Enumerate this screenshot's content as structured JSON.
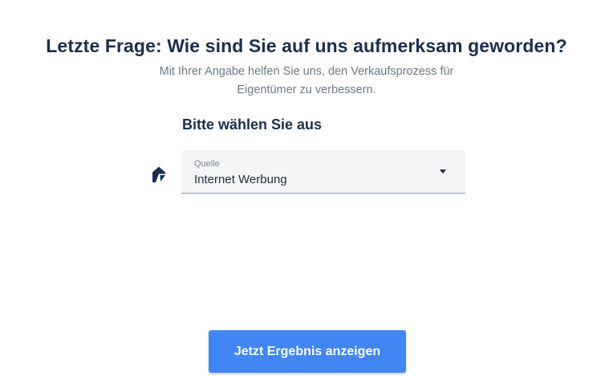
{
  "question": {
    "title": "Letzte Frage: Wie sind Sie auf uns aufmerksam geworden?",
    "subtitle_line1": "Mit Ihrer Angabe helfen Sie uns, den Verkaufsprozess für",
    "subtitle_line2": "Eigentümer zu verbessern."
  },
  "form": {
    "heading": "Bitte wählen Sie aus",
    "field_icon": "house-icon",
    "source_select": {
      "label": "Quelle",
      "selected_value": "Internet Werbung"
    }
  },
  "submit": {
    "label": "Jetzt Ergebnis anzeigen"
  },
  "colors": {
    "title": "#1b2f4d",
    "subtitle": "#6b7887",
    "button": "#4285f4",
    "select_bg": "#f4f5f7"
  }
}
